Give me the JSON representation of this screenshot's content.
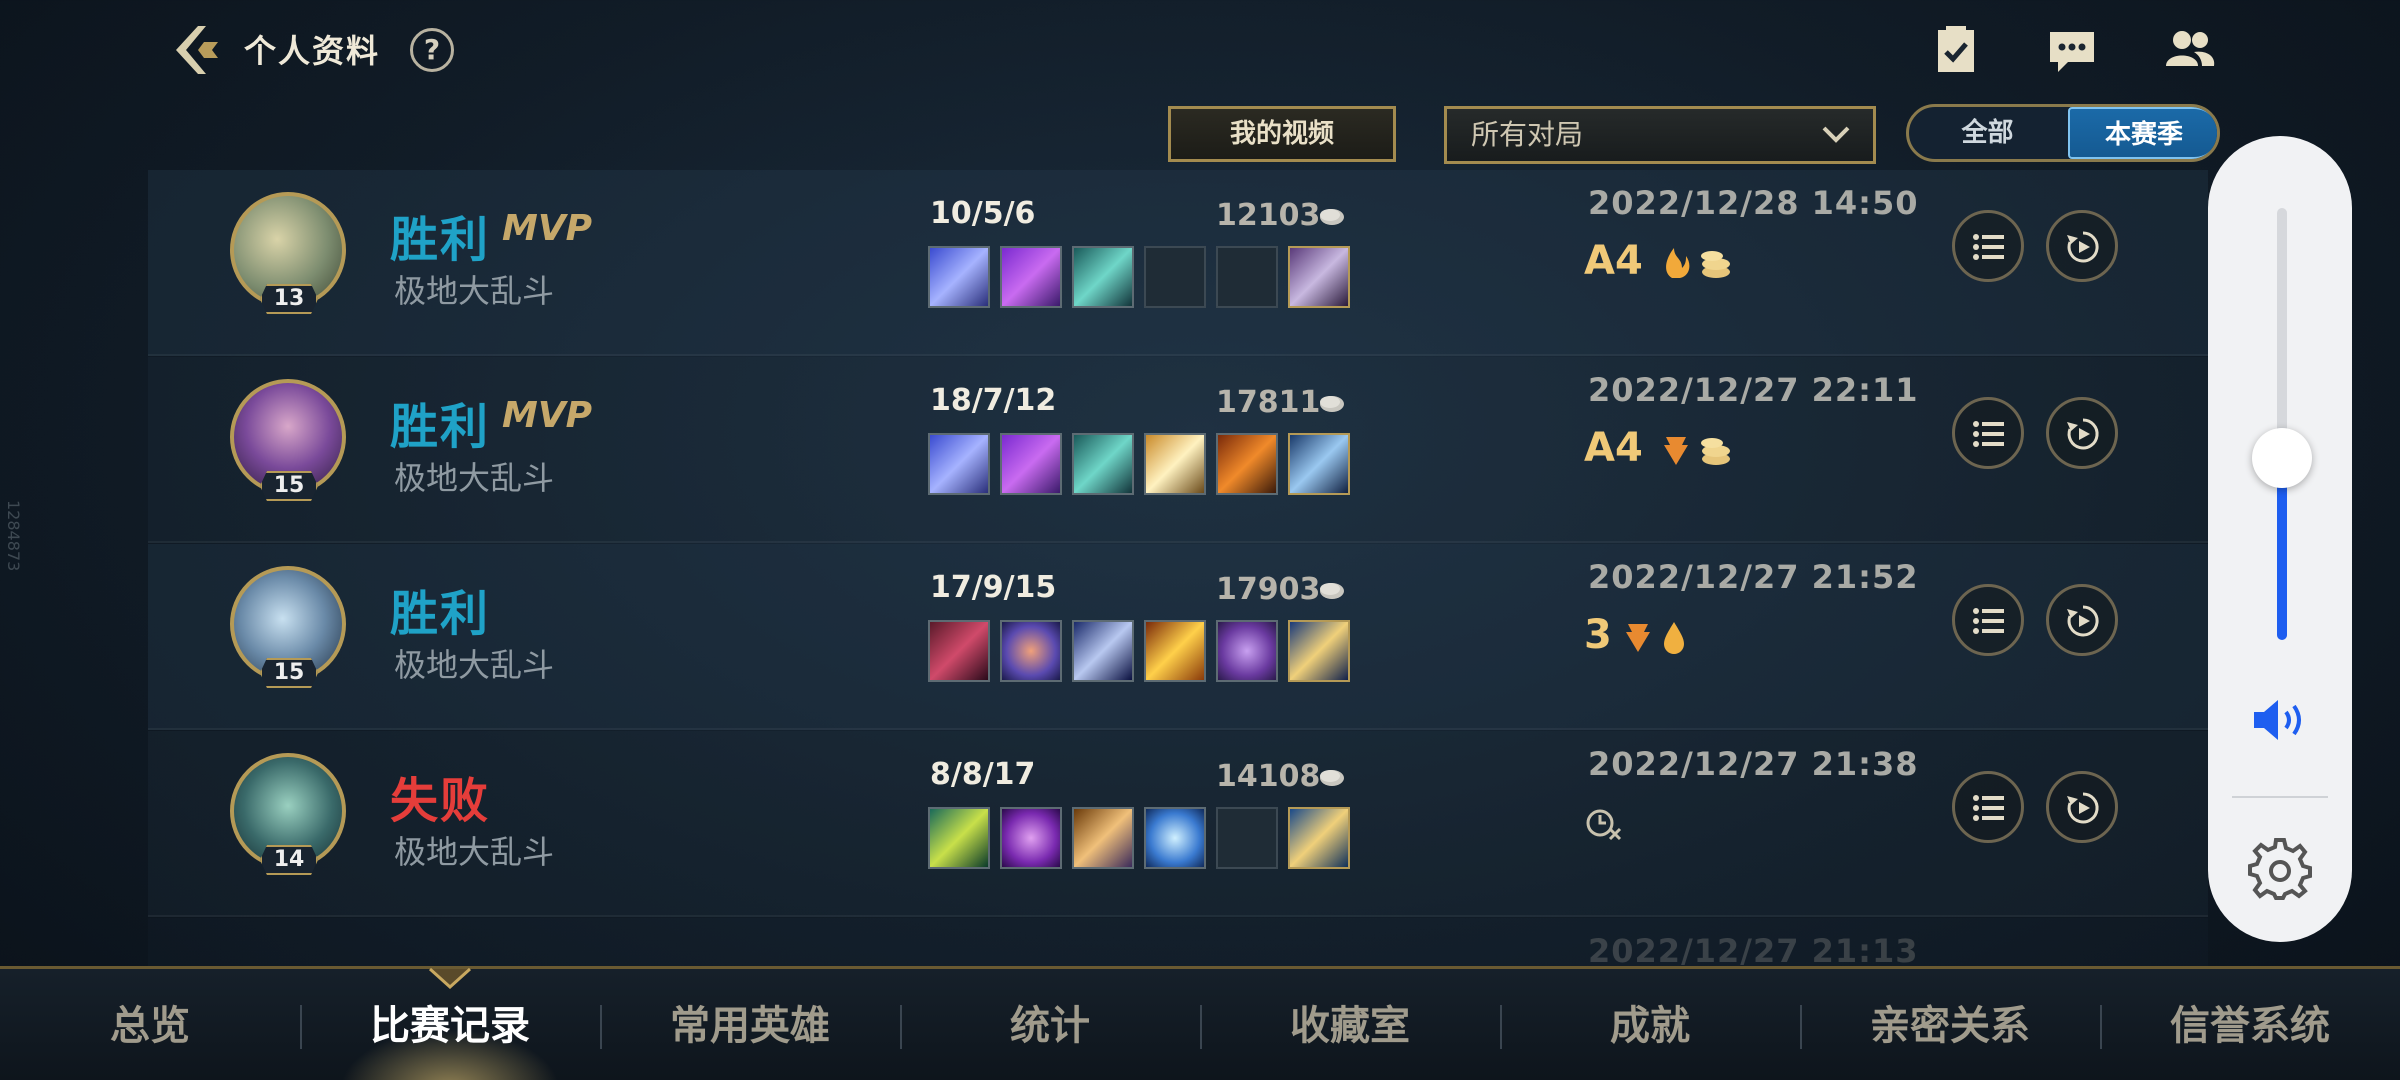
{
  "header": {
    "title": "个人资料",
    "help_label": "?"
  },
  "filters": {
    "my_videos_label": "我的视频",
    "match_type": "所有对局",
    "season_toggle": {
      "all_label": "全部",
      "current_label": "本赛季",
      "selected": "本赛季"
    }
  },
  "matches": [
    {
      "result": "胜利",
      "mvp": "MVP",
      "mode": "极地大乱斗",
      "level": "13",
      "kda": "10/5/6",
      "gold": "12103",
      "datetime": "2022/12/28 14:50",
      "badges": "A4"
    },
    {
      "result": "胜利",
      "mvp": "MVP",
      "mode": "极地大乱斗",
      "level": "15",
      "kda": "18/7/12",
      "gold": "17811",
      "datetime": "2022/12/27 22:11",
      "badges": "A4"
    },
    {
      "result": "胜利",
      "mvp": "",
      "mode": "极地大乱斗",
      "level": "15",
      "kda": "17/9/15",
      "gold": "17903",
      "datetime": "2022/12/27 21:52",
      "badges": "3"
    },
    {
      "result": "失败",
      "mvp": "",
      "mode": "极地大乱斗",
      "level": "14",
      "kda": "8/8/17",
      "gold": "14108",
      "datetime": "2022/12/27 21:38",
      "badges": ""
    },
    {
      "datetime": "2022/12/27 21:13"
    }
  ],
  "volume": {
    "level_percent": 43
  },
  "tabs": [
    "总览",
    "比赛记录",
    "常用英雄",
    "统计",
    "收藏室",
    "成就",
    "亲密关系",
    "信誉系统"
  ],
  "active_tab": "比赛记录",
  "side_text": "1284873",
  "colors": {
    "win": "#1fa2c7",
    "loss": "#e53d3a",
    "accent_gold": "#a38b4f",
    "volume_blue": "#1e5ef0"
  },
  "icons": [
    "back-arrow-icon",
    "help-icon",
    "checklist-icon",
    "chat-icon",
    "friends-icon",
    "chevron-down-icon",
    "gold-coin-icon",
    "list-icon",
    "replay-icon",
    "speaker-icon",
    "gear-icon"
  ]
}
